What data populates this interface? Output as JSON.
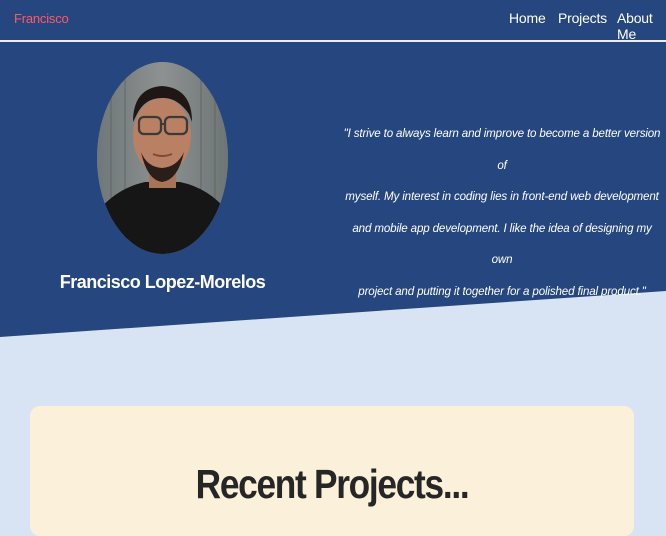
{
  "nav": {
    "brand": "Francisco",
    "links": [
      "Home",
      "Projects",
      "About Me"
    ]
  },
  "hero": {
    "name": "Francisco Lopez-Morelos",
    "quote_lines": [
      "\"I strive to always learn and improve to become a better version of",
      "myself. My interest in coding lies in front-end web development",
      "and mobile app development. I like the idea of designing my own",
      "project and putting it together for a polished final product.\""
    ]
  },
  "projects": {
    "title": "Recent Projects..."
  },
  "colors": {
    "nav_bg": "#26467f",
    "brand": "#ff5a63",
    "page_bg": "#d8e4f4",
    "card_bg": "#fbf0d9"
  }
}
